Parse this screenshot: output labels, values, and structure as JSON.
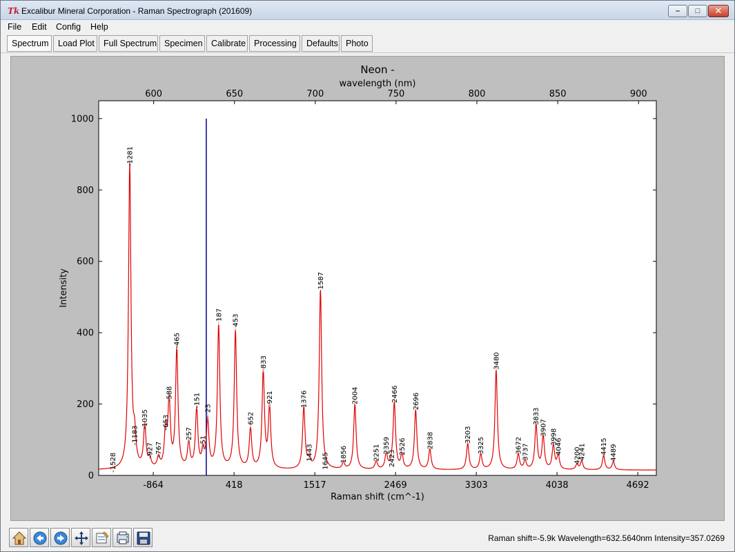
{
  "window": {
    "title": "Excalibur Mineral Corporation - Raman Spectrograph (201609)",
    "app_icon": "tk-icon",
    "buttons": [
      "minimize-icon",
      "maximize-icon",
      "close-icon"
    ]
  },
  "menu": {
    "items": [
      "File",
      "Edit",
      "Config",
      "Help"
    ]
  },
  "tabs": {
    "items": [
      "Spectrum",
      "Load Plot",
      "Full Spectrum",
      "Specimen",
      "Calibrate",
      "Processing",
      "Defaults",
      "Photo"
    ],
    "active": "Spectrum"
  },
  "chart_data": {
    "type": "line",
    "title": "Neon -",
    "top_axis_label": "wavelength (nm)",
    "xlabel": "Raman shift (cm^-1)",
    "ylabel": "Intensity",
    "ylim": [
      0,
      1050
    ],
    "y_ticks": [
      0,
      200,
      400,
      600,
      800,
      1000
    ],
    "bottom_ticks": [
      "-864",
      "418",
      "1517",
      "2469",
      "3303",
      "4038",
      "4692"
    ],
    "top_ticks": [
      "600",
      "650",
      "700",
      "750",
      "800",
      "850",
      "900"
    ],
    "wavelength_range_nm": [
      566,
      911
    ],
    "cursor_wavelength_nm": 632.56,
    "line_color": "#e00000",
    "cursor_color": "#00008b",
    "peaks": [
      {
        "label": "-1528",
        "wl": 574.8,
        "intensity": 14
      },
      {
        "label": "-1281",
        "wl": 585.2,
        "intensity": 872
      },
      {
        "label": "-1183",
        "wl": 588.2,
        "intensity": 90
      },
      {
        "label": "-1035",
        "wl": 594.5,
        "intensity": 135
      },
      {
        "label": "-927",
        "wl": 597.6,
        "intensity": 42
      },
      {
        "label": "-767",
        "wl": 603.0,
        "intensity": 45
      },
      {
        "label": "-653",
        "wl": 607.4,
        "intensity": 120
      },
      {
        "label": "-588",
        "wl": 609.6,
        "intensity": 200
      },
      {
        "label": "-465",
        "wl": 614.3,
        "intensity": 350
      },
      {
        "label": "-257",
        "wl": 621.7,
        "intensity": 85
      },
      {
        "label": "-151",
        "wl": 626.6,
        "intensity": 182
      },
      {
        "label": "-51",
        "wl": 630.5,
        "intensity": 62
      },
      {
        "label": "23",
        "wl": 633.4,
        "intensity": 150
      },
      {
        "label": "187",
        "wl": 640.2,
        "intensity": 418
      },
      {
        "label": "453",
        "wl": 650.6,
        "intensity": 403
      },
      {
        "label": "652",
        "wl": 659.9,
        "intensity": 128
      },
      {
        "label": "833",
        "wl": 667.8,
        "intensity": 286
      },
      {
        "label": "921",
        "wl": 671.7,
        "intensity": 187
      },
      {
        "label": "1376",
        "wl": 692.9,
        "intensity": 188
      },
      {
        "label": "1443",
        "wl": 696.2,
        "intensity": 38
      },
      {
        "label": "1587",
        "wl": 703.2,
        "intensity": 520
      },
      {
        "label": "1645",
        "wl": 706.0,
        "intensity": 15
      },
      {
        "label": "1856",
        "wl": 717.4,
        "intensity": 33
      },
      {
        "label": "2004",
        "wl": 724.5,
        "intensity": 198
      },
      {
        "label": "2251",
        "wl": 737.7,
        "intensity": 38
      },
      {
        "label": "2359",
        "wl": 743.9,
        "intensity": 58
      },
      {
        "label": "2423",
        "wl": 747.2,
        "intensity": 22
      },
      {
        "label": "2466",
        "wl": 748.9,
        "intensity": 202
      },
      {
        "label": "2526",
        "wl": 753.6,
        "intensity": 55
      },
      {
        "label": "2696",
        "wl": 762.1,
        "intensity": 182
      },
      {
        "label": "2838",
        "wl": 770.9,
        "intensity": 72
      },
      {
        "label": "3203",
        "wl": 794.3,
        "intensity": 88
      },
      {
        "label": "3325",
        "wl": 802.4,
        "intensity": 58
      },
      {
        "label": "3480",
        "wl": 811.9,
        "intensity": 295
      },
      {
        "label": "3672",
        "wl": 825.6,
        "intensity": 58
      },
      {
        "label": "3737",
        "wl": 829.8,
        "intensity": 40
      },
      {
        "label": "3833",
        "wl": 836.6,
        "intensity": 140
      },
      {
        "label": "3907",
        "wl": 841.0,
        "intensity": 108
      },
      {
        "label": "3998",
        "wl": 847.3,
        "intensity": 82
      },
      {
        "label": "4046",
        "wl": 850.3,
        "intensity": 55
      },
      {
        "label": "4200",
        "wl": 861.9,
        "intensity": 30
      },
      {
        "label": "4241",
        "wl": 864.8,
        "intensity": 40
      },
      {
        "label": "4415",
        "wl": 878.4,
        "intensity": 55
      },
      {
        "label": "4489",
        "wl": 884.4,
        "intensity": 38
      }
    ],
    "baseline": 15
  },
  "toolbar": {
    "buttons": [
      "home-icon",
      "back-icon",
      "forward-icon",
      "pan-icon",
      "configure-subplots-icon",
      "zoom-icon",
      "save-icon"
    ]
  },
  "status": {
    "text": "Raman shift=-5.9k Wavelength=632.5640nm Intensity=357.0269"
  }
}
